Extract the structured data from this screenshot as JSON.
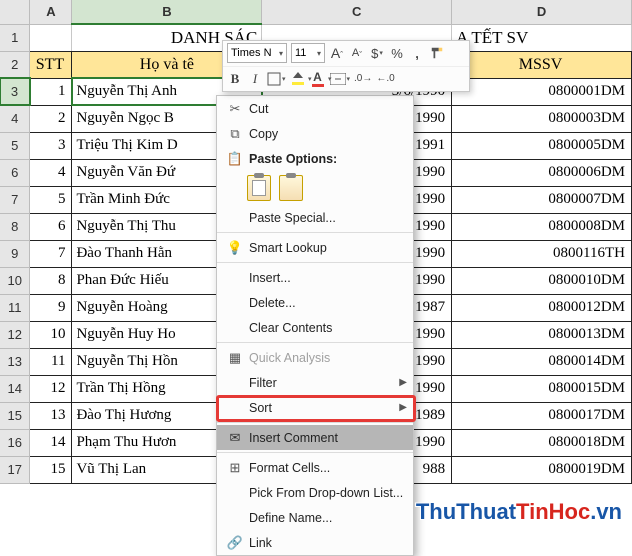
{
  "columns": [
    "A",
    "B",
    "C",
    "D"
  ],
  "title": {
    "left": "DANH SÁC",
    "right": "A TẾT SV"
  },
  "headers": {
    "a": "STT",
    "b": "Họ và tê",
    "c": "",
    "d": "MSSV"
  },
  "rows": [
    {
      "n": 1,
      "name": "Nguyễn Thị Anh",
      "dob": "3/6/1990",
      "ms": "0800001DM"
    },
    {
      "n": 2,
      "name": "Nguyễn Ngọc B",
      "dob": "1990",
      "ms": "0800003DM"
    },
    {
      "n": 3,
      "name": "Triệu Thị Kim D",
      "dob": "1991",
      "ms": "0800005DM"
    },
    {
      "n": 4,
      "name": "Nguyễn Văn Đứ",
      "dob": "1990",
      "ms": "0800006DM"
    },
    {
      "n": 5,
      "name": "Trần Minh Đức",
      "dob": "1990",
      "ms": "0800007DM"
    },
    {
      "n": 6,
      "name": "Nguyễn Thị Thu",
      "dob": "1990",
      "ms": "0800008DM"
    },
    {
      "n": 7,
      "name": "Đào Thanh Hằn",
      "dob": "1990",
      "ms": "0800116TH"
    },
    {
      "n": 8,
      "name": "Phan Đức Hiếu",
      "dob": "1990",
      "ms": "0800010DM"
    },
    {
      "n": 9,
      "name": "Nguyễn Hoàng",
      "dob": "1987",
      "ms": "0800012DM"
    },
    {
      "n": 10,
      "name": "Nguyễn Huy Ho",
      "dob": "1990",
      "ms": "0800013DM"
    },
    {
      "n": 11,
      "name": "Nguyễn Thị Hồn",
      "dob": "1990",
      "ms": "0800014DM"
    },
    {
      "n": 12,
      "name": "Trần Thị Hồng",
      "dob": "1990",
      "ms": "0800015DM"
    },
    {
      "n": 13,
      "name": "Đào Thị Hương",
      "dob": "1989",
      "ms": "0800017DM"
    },
    {
      "n": 14,
      "name": "Phạm Thu Hươn",
      "dob": "1990",
      "ms": "0800018DM"
    },
    {
      "n": 15,
      "name": "Vũ Thị Lan",
      "dob": "988",
      "ms": "0800019DM"
    }
  ],
  "minitb": {
    "font": "Times N",
    "size": "11",
    "bold": "B",
    "italic": "I",
    "incfont": "A",
    "decfont": "A",
    "currency": "$",
    "percent": "%",
    "comma": ",",
    "fontcolor_letter": "A"
  },
  "ctx": {
    "cut": "Cut",
    "copy": "Copy",
    "paste_options": "Paste Options:",
    "paste_special": "Paste Special...",
    "smart_lookup": "Smart Lookup",
    "insert": "Insert...",
    "delete": "Delete...",
    "clear": "Clear Contents",
    "quick": "Quick Analysis",
    "filter": "Filter",
    "sort": "Sort",
    "insert_comment": "Insert Comment",
    "format_cells": "Format Cells...",
    "pick_list": "Pick From Drop-down List...",
    "define_name": "Define Name...",
    "link": "Link"
  },
  "watermark": {
    "a": "ThuThuat",
    "b": "TinHoc",
    "c": ".vn"
  }
}
